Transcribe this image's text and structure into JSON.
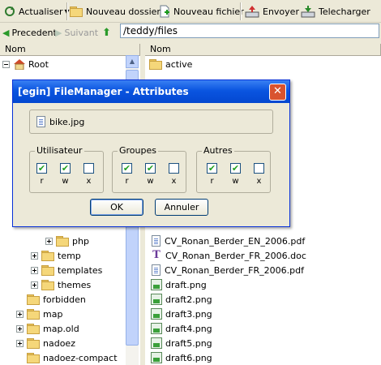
{
  "toolbar": {
    "refresh_label": "Actualiser",
    "new_folder_label": "Nouveau dossier",
    "new_file_label": "Nouveau fichier",
    "send_label": "Envoyer",
    "download_label": "Telecharger"
  },
  "navbar": {
    "back_label": "Precedent",
    "forward_label": "Suivant",
    "path": "/teddy/files"
  },
  "left_pane": {
    "header": "Nom",
    "root_label": "Root",
    "items": [
      "php",
      "temp",
      "templates",
      "themes",
      "forbidden",
      "map",
      "map.old",
      "nadoez",
      "nadoez-compact"
    ]
  },
  "right_pane": {
    "header": "Nom",
    "items": [
      "active",
      "CV_Ronan_Berder_EN_2006.pdf",
      "CV_Ronan_Berder_FR_2006.doc",
      "CV_Ronan_Berder_FR_2006.pdf",
      "draft.png",
      "draft2.png",
      "draft3.png",
      "draft4.png",
      "draft5.png",
      "draft6.png"
    ]
  },
  "dialog": {
    "title": "[egin] FileManager - Attributes",
    "close_glyph": "✕",
    "filename": "bike.jpg",
    "groups": [
      {
        "title": "Utilisateur",
        "labels": [
          "r",
          "w",
          "x"
        ],
        "checked": [
          true,
          true,
          false
        ]
      },
      {
        "title": "Groupes",
        "labels": [
          "r",
          "w",
          "x"
        ],
        "checked": [
          true,
          true,
          false
        ]
      },
      {
        "title": "Autres",
        "labels": [
          "r",
          "w",
          "x"
        ],
        "checked": [
          true,
          true,
          false
        ]
      }
    ],
    "ok_label": "OK",
    "cancel_label": "Annuler"
  },
  "icons": {
    "refresh": "refresh-icon",
    "new_folder": "new-folder-icon",
    "new_file": "new-file-icon",
    "upload": "upload-icon",
    "download": "download-icon",
    "back": "back-arrow-icon",
    "forward": "forward-arrow-icon",
    "up": "up-arrow-icon"
  },
  "colors": {
    "titlebar": "#0a55e0",
    "close_button": "#d9532f",
    "checkmark": "#21a121"
  }
}
